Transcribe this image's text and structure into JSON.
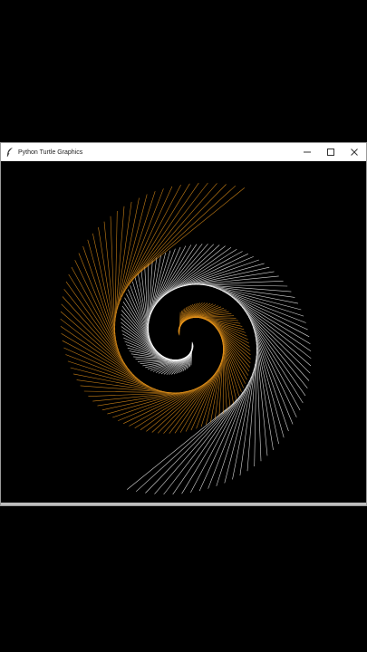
{
  "window": {
    "title": "Python Turtle Graphics",
    "icon": "feather-icon",
    "controls": {
      "minimize": "minimize-icon",
      "maximize": "maximize-icon",
      "close": "close-icon"
    }
  },
  "drawing": {
    "background": "#000000",
    "colors": [
      "#ffffff",
      "#e8941a"
    ]
  }
}
